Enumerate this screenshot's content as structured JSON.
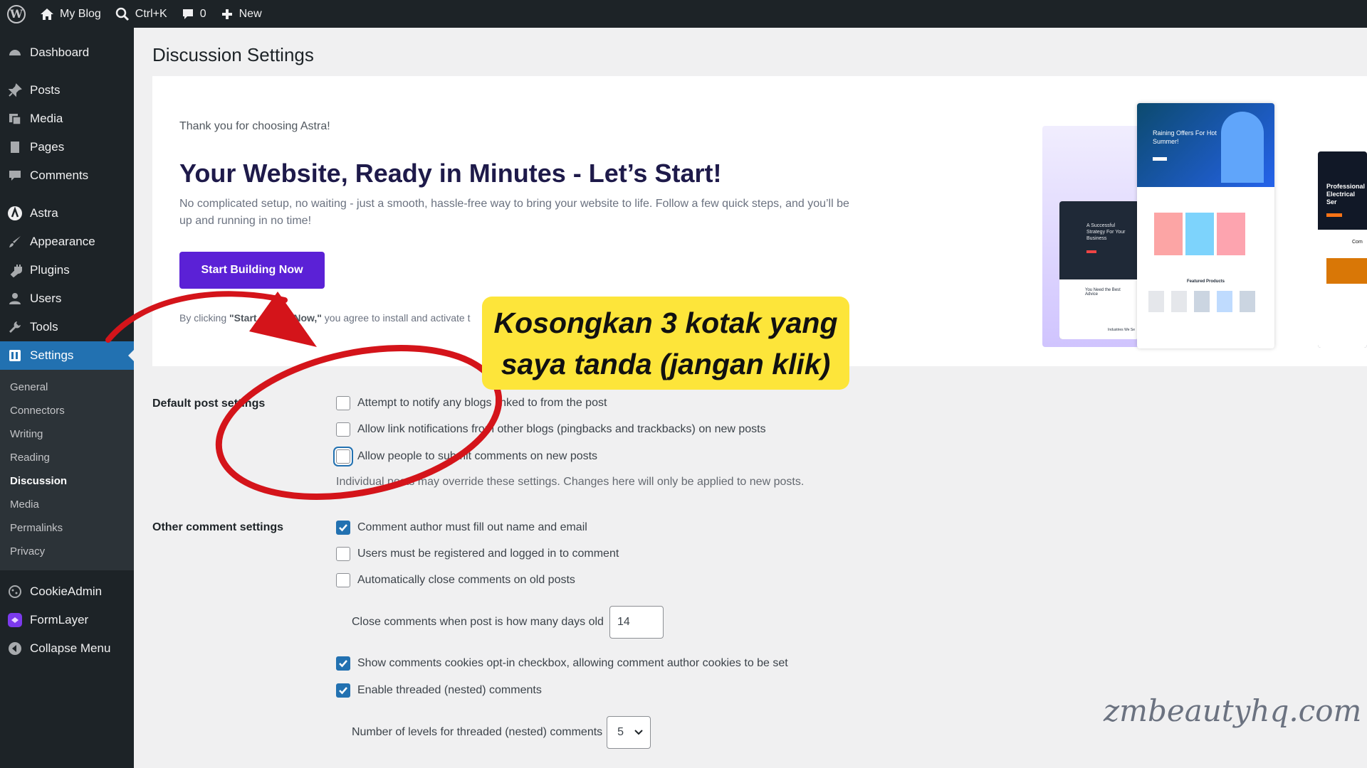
{
  "adminbar": {
    "site_name": "My Blog",
    "search_shortcut": "Ctrl+K",
    "comments_count": "0",
    "new_label": "New"
  },
  "sidebar": {
    "items": [
      {
        "label": "Dashboard",
        "icon": "dashboard-icon"
      },
      {
        "label": "Posts",
        "icon": "pin-icon"
      },
      {
        "label": "Media",
        "icon": "media-icon"
      },
      {
        "label": "Pages",
        "icon": "page-icon"
      },
      {
        "label": "Comments",
        "icon": "comment-icon"
      },
      {
        "label": "Astra",
        "icon": "astra-icon"
      },
      {
        "label": "Appearance",
        "icon": "brush-icon"
      },
      {
        "label": "Plugins",
        "icon": "plug-icon"
      },
      {
        "label": "Users",
        "icon": "user-icon"
      },
      {
        "label": "Tools",
        "icon": "wrench-icon"
      },
      {
        "label": "Settings",
        "icon": "settings-icon"
      }
    ],
    "submenu": [
      "General",
      "Connectors",
      "Writing",
      "Reading",
      "Discussion",
      "Media",
      "Permalinks",
      "Privacy"
    ],
    "extra": [
      {
        "label": "CookieAdmin",
        "icon": "cookie-icon"
      },
      {
        "label": "FormLayer",
        "icon": "formlayer-icon"
      },
      {
        "label": "Collapse Menu",
        "icon": "collapse-icon"
      }
    ]
  },
  "page": {
    "title": "Discussion Settings"
  },
  "banner": {
    "thanks": "Thank you for choosing Astra!",
    "headline": "Your Website, Ready in Minutes - Let’s Start!",
    "description": "No complicated setup, no waiting - just a smooth, hassle-free way to bring your website to life. Follow a few quick steps, and you’ll be up and running in no time!",
    "cta": "Start Building Now",
    "terms_prefix": "By clicking ",
    "terms_bold_start": "\"Start",
    "terms_bold_end": "Now,\"",
    "terms_suffix": " you agree to install and activate t",
    "mock_left_title": "A Successful Strategy For Your Business",
    "mock_left_sub": "You Need the Best Advice",
    "mock_left_foot": "Industries We Se",
    "mock_center_title": "Raining Offers For Hot Summer!",
    "mock_center_section": "Featured Products",
    "mock_right_title": "Professional Electrical Ser",
    "mock_right_foot": "Com"
  },
  "default_post": {
    "label": "Default post settings",
    "options": [
      {
        "text": "Attempt to notify any blogs linked to from the post",
        "checked": false
      },
      {
        "text": "Allow link notifications from other blogs (pingbacks and trackbacks) on new posts",
        "checked": false
      },
      {
        "text": "Allow people to submit comments on new posts",
        "checked": false
      }
    ],
    "note": "Individual posts may override these settings. Changes here will only be applied to new posts."
  },
  "other_comment": {
    "label": "Other comment settings",
    "options": [
      {
        "text": "Comment author must fill out name and email",
        "checked": true
      },
      {
        "text": "Users must be registered and logged in to comment",
        "checked": false
      },
      {
        "text": "Automatically close comments on old posts",
        "checked": false
      }
    ],
    "close_days_label": "Close comments when post is how many days old",
    "close_days_value": "14",
    "options2": [
      {
        "text": "Show comments cookies opt-in checkbox, allowing comment author cookies to be set",
        "checked": true
      },
      {
        "text": "Enable threaded (nested) comments",
        "checked": true
      }
    ],
    "levels_label": "Number of levels for threaded (nested) comments",
    "levels_value": "5"
  },
  "callout": {
    "line1": "Kosongkan 3 kotak yang",
    "line2": "saya tanda (jangan klik)"
  },
  "watermark": "zmbeautyhq.com",
  "colors": {
    "admin_dark": "#1d2327",
    "accent": "#2271b1",
    "cta_purple": "#5b21d6",
    "callout_yellow": "#fde53a",
    "annotation_red": "#d4141a"
  }
}
